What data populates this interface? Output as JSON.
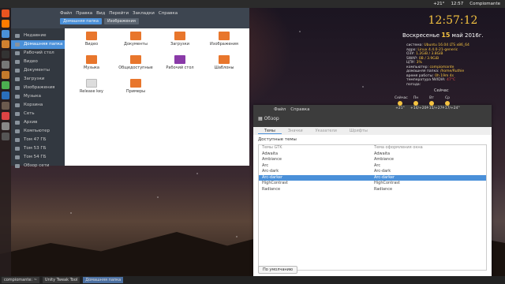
{
  "topbar": {
    "items": [
      "+21°",
      "12:57",
      "Compiomante"
    ]
  },
  "launcher_icons": [
    "ubuntu-icon",
    "firefox-icon",
    "chromium-icon",
    "files-icon",
    "terminal-icon",
    "settings-icon",
    "files-icon-2",
    "calc-icon",
    "writer-icon",
    "gimp-icon",
    "software-icon",
    "system-icon",
    "trash-icon"
  ],
  "file_manager": {
    "menu": [
      "Файл",
      "Правка",
      "Вид",
      "Перейти",
      "Закладки",
      "Справка"
    ],
    "tabs": [
      "Домашняя папка",
      "Изображения"
    ],
    "sidebar": [
      "Недавние",
      "Домашняя папка",
      "Рабочий стол",
      "Видео",
      "Документы",
      "Загрузки",
      "Изображения",
      "Музыка",
      "Корзина",
      "Сеть",
      "Архив",
      "Компьютер",
      "Том 47 ГБ",
      "Том 53 ГБ",
      "Том 54 ГБ",
      "Обзор сети"
    ],
    "files": [
      {
        "name": "Видео",
        "icon": "video-folder-icon"
      },
      {
        "name": "Документы",
        "icon": "documents-folder-icon"
      },
      {
        "name": "Загрузки",
        "icon": "downloads-folder-icon"
      },
      {
        "name": "Изображения",
        "icon": "pictures-folder-icon"
      },
      {
        "name": "Музыка",
        "icon": "music-folder-icon"
      },
      {
        "name": "Общедоступные",
        "icon": "public-folder-icon"
      },
      {
        "name": "Рабочий стол",
        "icon": "desktop-folder-icon"
      },
      {
        "name": "Шаблоны",
        "icon": "templates-folder-icon"
      },
      {
        "name": "Release key",
        "icon": "document-icon"
      },
      {
        "name": "Примеры",
        "icon": "examples-folder-icon"
      }
    ]
  },
  "tweak": {
    "menu": [
      "Файл",
      "Справка"
    ],
    "subtitle": "Обзор",
    "tabs": [
      "Темы",
      "Значки",
      "Указатели",
      "Шрифты"
    ],
    "section": "Доступные темы",
    "col1": "Темы GTK",
    "col2": "Тема оформления окна",
    "rows": [
      [
        "Adwaita",
        "Adwaita"
      ],
      [
        "Ambiance",
        "Ambiance"
      ],
      [
        "Arc",
        "Arc"
      ],
      [
        "Arc-dark",
        "Arc-dark"
      ],
      [
        "Arc-darker",
        "Arc-darker"
      ],
      [
        "HighContrast",
        "HighContrast"
      ],
      [
        "Radiance",
        "Radiance"
      ]
    ],
    "selected": 4,
    "button": "По умолчанию"
  },
  "conky": {
    "clock": "12:57:12",
    "date_pre": "Воскресенье ",
    "date_day": "15",
    "date_post": " май 2016г.",
    "lines": [
      [
        "система:",
        "Ubuntu 16.04 LTS x86_64"
      ],
      [
        "ядро:",
        "Linux 4.4.0-21-generic"
      ],
      [
        "ОЗУ:",
        "1.2GiB / 3.8GiB"
      ],
      [
        "SWAP:",
        "0B / 3.9GiB"
      ],
      [
        "ЦПУ:",
        "3%"
      ],
      [
        "компьютер:",
        "compiomante"
      ],
      [
        "домашняя папка:",
        "/home/Ruthie"
      ],
      [
        "время работы:",
        "0h 19m 4s"
      ],
      [
        "температура NVIDIA:",
        "47°C"
      ],
      [
        "погода:",
        ""
      ]
    ],
    "weather_title": "Сейчас",
    "weather": [
      [
        "Сейчас",
        "+21°"
      ],
      [
        "Пн",
        "+14/+20°"
      ],
      [
        "Вт",
        "+15/+27°"
      ],
      [
        "Ср",
        "+17/+24°"
      ]
    ]
  },
  "taskbar": [
    "compiomante: ~",
    "Unity Tweak Tool",
    "Домашняя папка"
  ]
}
